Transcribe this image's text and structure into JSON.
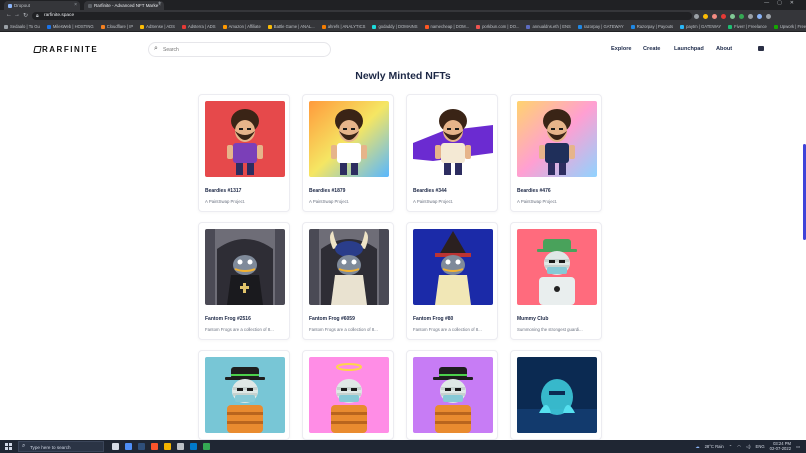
{
  "browser": {
    "tabs": [
      {
        "title": "Dropout",
        "color": "#8ab4f8"
      },
      {
        "title": "Rarfinite - Advanced NFT Marke",
        "color": "#5f6368"
      }
    ],
    "new_tab": "+",
    "url": "rarfinite.space",
    "bookmarks": [
      {
        "label": "Sedaalo | To Gu",
        "color": "#9aa0a6"
      },
      {
        "label": "MilesWeb | HOSTING",
        "color": "#1a73e8"
      },
      {
        "label": "Cloudflare | IP",
        "color": "#f38020"
      },
      {
        "label": "AdSense | ADS",
        "color": "#fbbc04"
      },
      {
        "label": "Adsterra | ADS",
        "color": "#e53935"
      },
      {
        "label": "Amazon | Affiliate",
        "color": "#ff9900"
      },
      {
        "label": "Battle Game | ANAL...",
        "color": "#fbbc04"
      },
      {
        "label": "ahrefs | ANALYTICS",
        "color": "#f57c00"
      },
      {
        "label": "godaddy | DOMAINS",
        "color": "#1bdbdb"
      },
      {
        "label": "namecheap | DOM...",
        "color": "#ff5722"
      },
      {
        "label": "porkbun.com | DO...",
        "color": "#ef5350"
      },
      {
        "label": "annualdns.eth | ENS",
        "color": "#5c6bc0"
      },
      {
        "label": "razorpay | GATEWAY",
        "color": "#1e88e5"
      },
      {
        "label": "Razorpay | Payouts",
        "color": "#1e88e5"
      },
      {
        "label": "paytm | GATEWAY",
        "color": "#29b6f6"
      },
      {
        "label": "Fiverr | Freelance",
        "color": "#1dbf73"
      },
      {
        "label": "Upwork | Freelance",
        "color": "#14a800"
      },
      {
        "label": "uiGradients | TOOLS",
        "color": "#ec407a"
      }
    ]
  },
  "site": {
    "logo": "RARFINITE",
    "search_placeholder": "Search",
    "nav": [
      "Explore",
      "Create",
      "Launchpad",
      "About"
    ],
    "heading": "Newly Minted NFTs"
  },
  "cards": [
    {
      "name": "Beardies #1317",
      "desc": "A PaintSwap Project.",
      "thumb": "beardie-red"
    },
    {
      "name": "Beardies #1879",
      "desc": "A PaintSwap Project.",
      "thumb": "beardie-rainbow"
    },
    {
      "name": "Beardies #344",
      "desc": "A PaintSwap Project.",
      "thumb": "beardie-purple"
    },
    {
      "name": "Beardies #476",
      "desc": "A PaintSwap Project.",
      "thumb": "beardie-pastel"
    },
    {
      "name": "Fantom Frog #2516",
      "desc": "Fantom Frogs are a collection of 8...",
      "thumb": "frog-knight"
    },
    {
      "name": "Fantom Frog #6059",
      "desc": "Fantom Frogs are a collection of 8...",
      "thumb": "frog-viking"
    },
    {
      "name": "Fantom Frog #80",
      "desc": "Fantom Frogs are a collection of 8...",
      "thumb": "frog-wizard"
    },
    {
      "name": "Mummy Club",
      "desc": "Summoning the strongest guardi...",
      "thumb": "mummy-pink"
    },
    {
      "name": "",
      "desc": "",
      "thumb": "mummy-teal"
    },
    {
      "name": "",
      "desc": "",
      "thumb": "mummy-halo"
    },
    {
      "name": "",
      "desc": "",
      "thumb": "mummy-purple"
    },
    {
      "name": "",
      "desc": "",
      "thumb": "mummy-dark"
    }
  ],
  "taskbar": {
    "search_placeholder": "Type here to search",
    "weather": "28°C  Rain",
    "lang": "ENG",
    "time": "03:24 PM",
    "date": "02-07-2022"
  },
  "colors": {
    "accent": "#3f43d9",
    "heading": "#1c2745"
  }
}
